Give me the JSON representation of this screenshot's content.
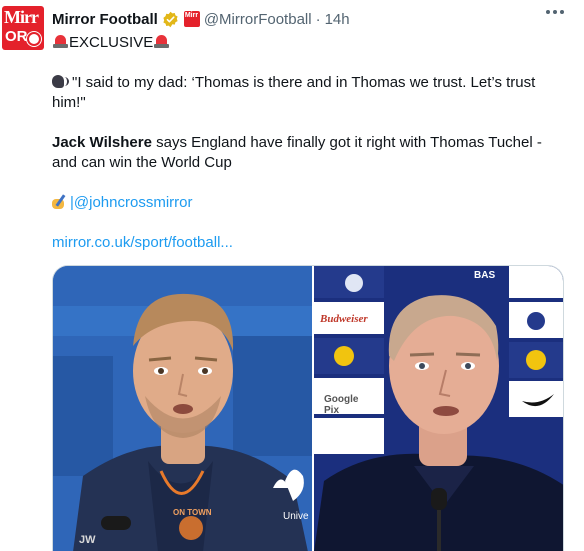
{
  "tweet": {
    "display_name": "Mirror Football",
    "handle": "@MirrorFootball",
    "separator": "·",
    "time": "14h",
    "line_exclusive": "EXCLUSIVE",
    "quote": "\"I said to my dad: ‘Thomas is there and in Thomas we trust. Let’s trust him!\"",
    "headline_bold": "Jack Wilshere",
    "headline_rest": " says England have finally got it right with Thomas Tuchel - and can win the World Cup",
    "author_handle": "|@johncrossmirror",
    "link": "mirror.co.uk/sport/football..."
  },
  "avatar": {
    "logo_top": "Mirr",
    "logo_bottom": "OR"
  },
  "affiliate_badge": {
    "text": "Mirr"
  },
  "media": {
    "left_photo": {
      "jacket_text_1": "ON TOWN",
      "jacket_text_2": "Unive",
      "initials": "JW"
    },
    "right_photo": {
      "board_text_1": "Budweiser",
      "board_text_2": "Google Pix",
      "board_text_3": "BAS"
    }
  },
  "colors": {
    "accent": "#1d9bf0",
    "brand_red": "#e4212b",
    "verified_gold": "#e2b719",
    "muted": "#536471"
  }
}
